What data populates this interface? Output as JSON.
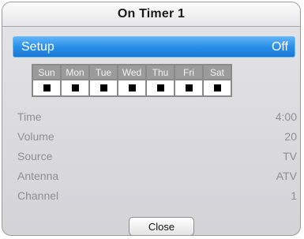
{
  "dialog": {
    "title": "On Timer  1"
  },
  "setup": {
    "label": "Setup",
    "value": "Off"
  },
  "days": [
    {
      "name": "Sun",
      "checked": true
    },
    {
      "name": "Mon",
      "checked": true
    },
    {
      "name": "Tue",
      "checked": true
    },
    {
      "name": "Wed",
      "checked": true
    },
    {
      "name": "Thu",
      "checked": true
    },
    {
      "name": "Fri",
      "checked": true
    },
    {
      "name": "Sat",
      "checked": true
    }
  ],
  "settings": [
    {
      "label": "Time",
      "value": "4:00"
    },
    {
      "label": "Volume",
      "value": "20"
    },
    {
      "label": "Source",
      "value": "TV"
    },
    {
      "label": "Antenna",
      "value": "ATV"
    },
    {
      "label": "Channel",
      "value": "1"
    }
  ],
  "buttons": {
    "close": "Close"
  },
  "colors": {
    "highlight": "#2a8fe8",
    "muted_text": "#8f8f8f"
  }
}
